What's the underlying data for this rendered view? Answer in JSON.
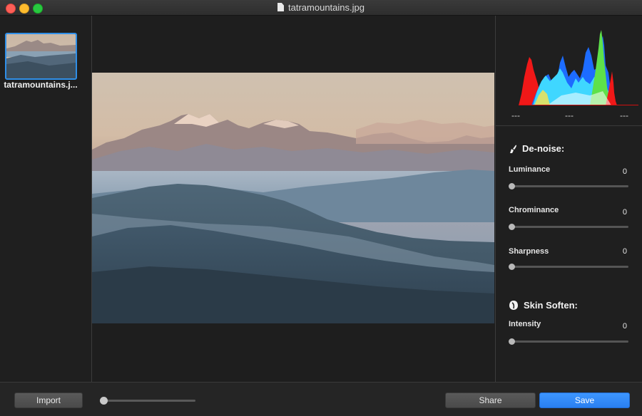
{
  "window": {
    "title": "tatramountains.jpg"
  },
  "sidebar": {
    "items": [
      {
        "label": "tatramountains.jpg",
        "display_label": "tatramountains.j..."
      }
    ]
  },
  "histogram": {
    "labels": [
      "---",
      "---",
      "---"
    ]
  },
  "denoise": {
    "title": "De-noise:",
    "icon": "brush-icon",
    "sliders": [
      {
        "label": "Luminance",
        "value": "0",
        "level": 0
      },
      {
        "label": "Chrominance",
        "value": "0",
        "level": 0
      },
      {
        "label": "Sharpness",
        "value": "0",
        "level": 0
      }
    ]
  },
  "skin_soften": {
    "title": "Skin Soften:",
    "icon": "face-icon",
    "sliders": [
      {
        "label": "Intensity",
        "value": "0",
        "level": 0
      }
    ]
  },
  "footer": {
    "import_label": "Import",
    "share_label": "Share",
    "save_label": "Save",
    "zoom_level": 0
  },
  "colors": {
    "accent": "#2f8fe8",
    "save_button": "#2a7ff0"
  }
}
